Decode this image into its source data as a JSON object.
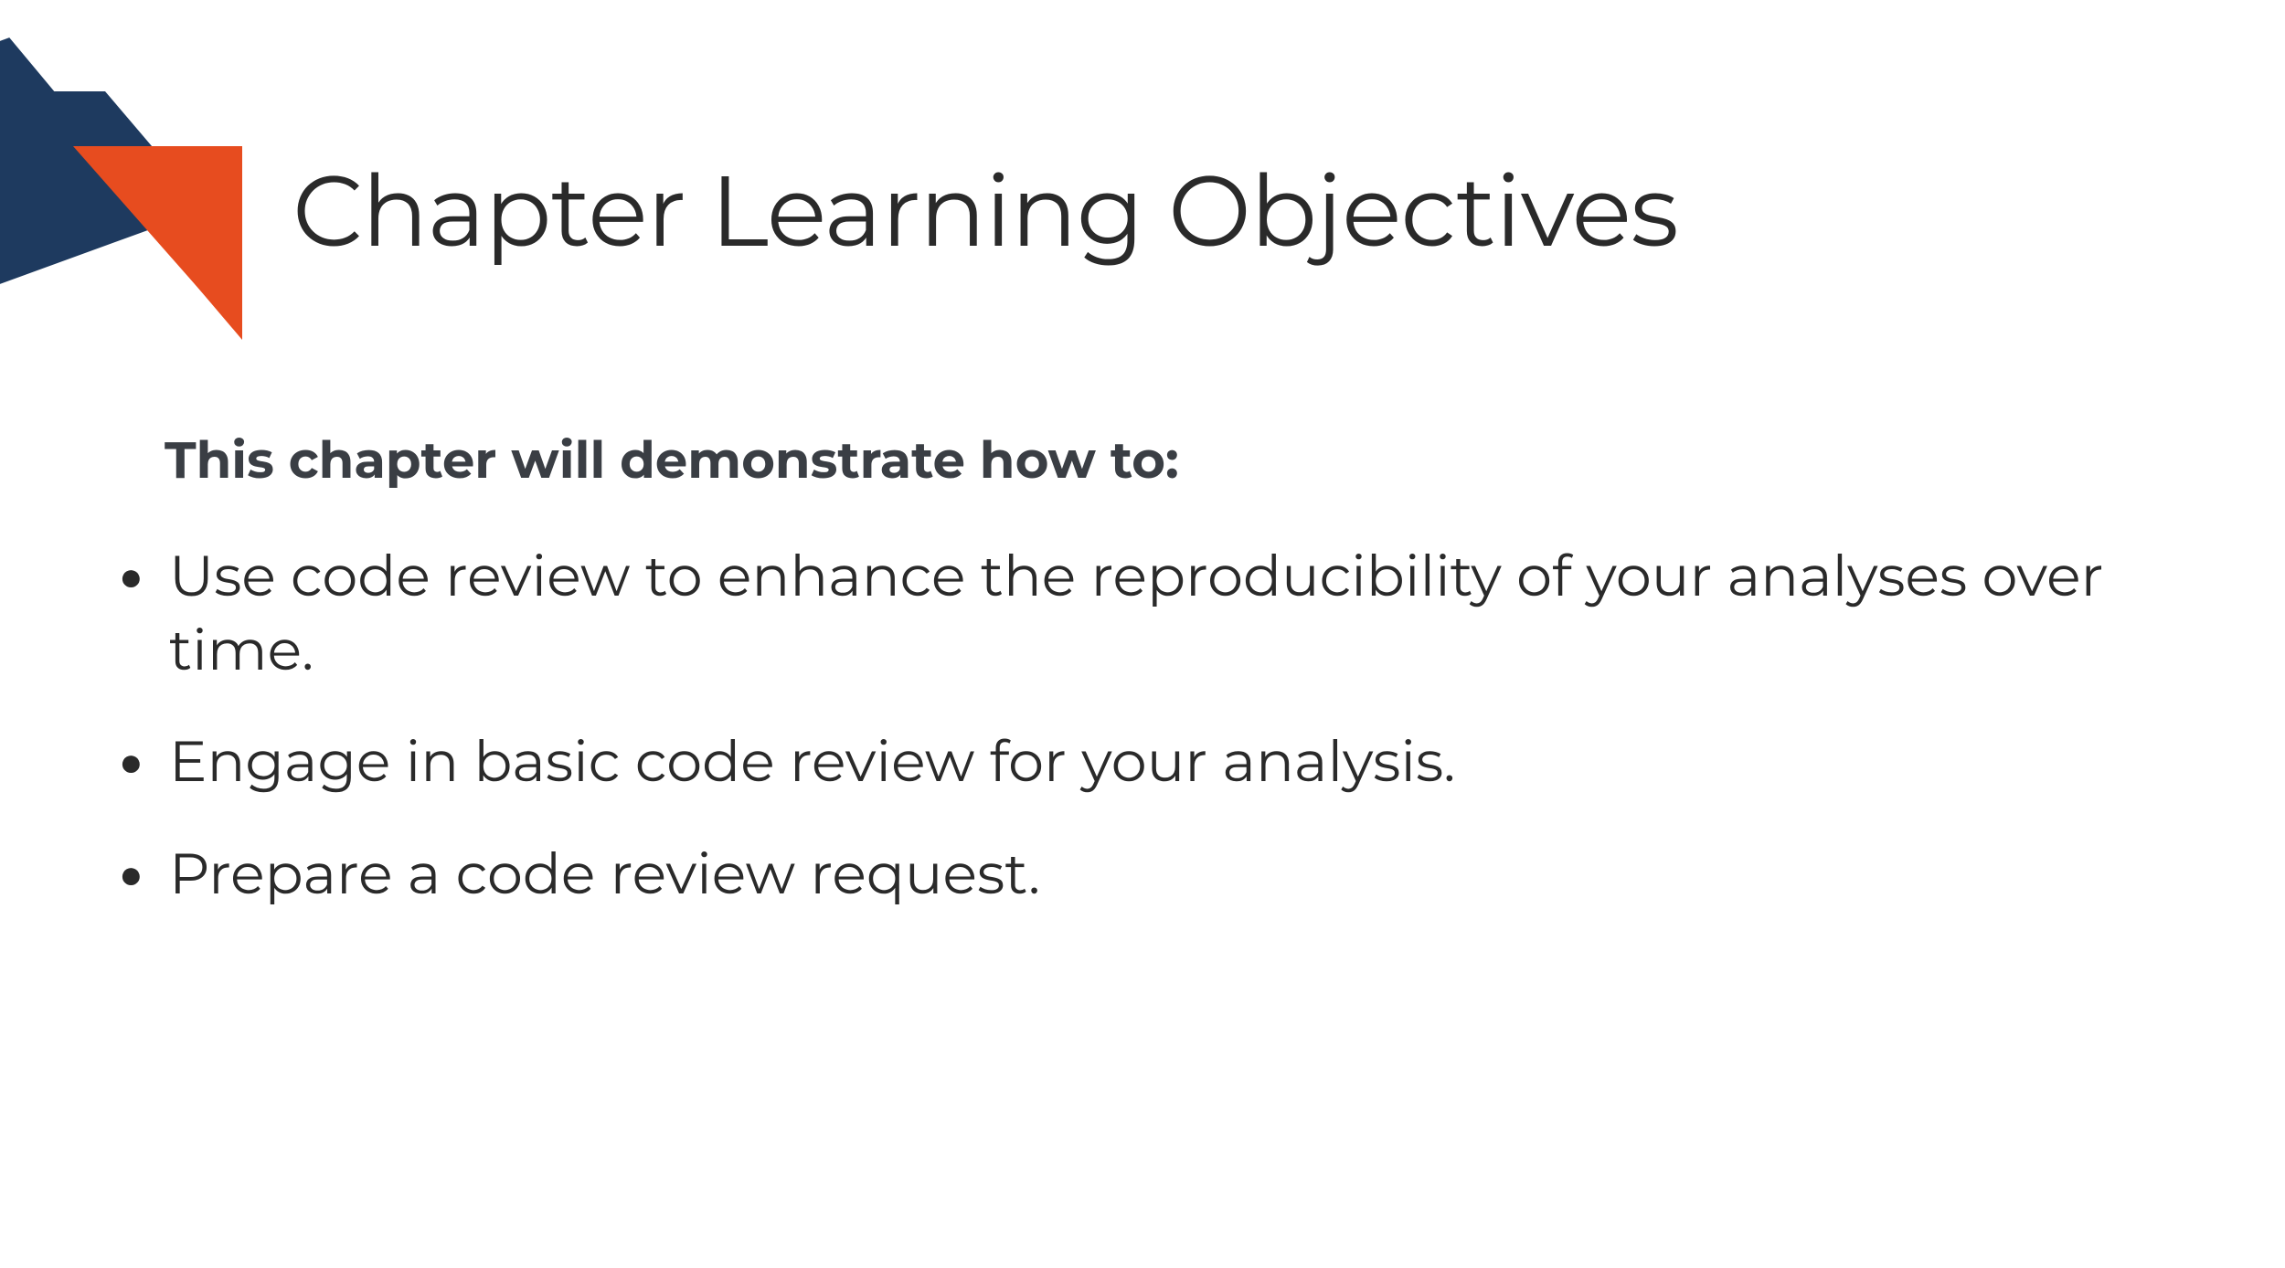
{
  "title": "Chapter Learning Objectives",
  "intro": "This chapter will demonstrate how to:",
  "objectives": [
    "Use code review to enhance the reproducibility of your analyses over time.",
    "Engage in basic code review for your analysis.",
    "Prepare a code review request."
  ],
  "colors": {
    "navy": "#1e3a5f",
    "orange": "#e74c1f"
  }
}
